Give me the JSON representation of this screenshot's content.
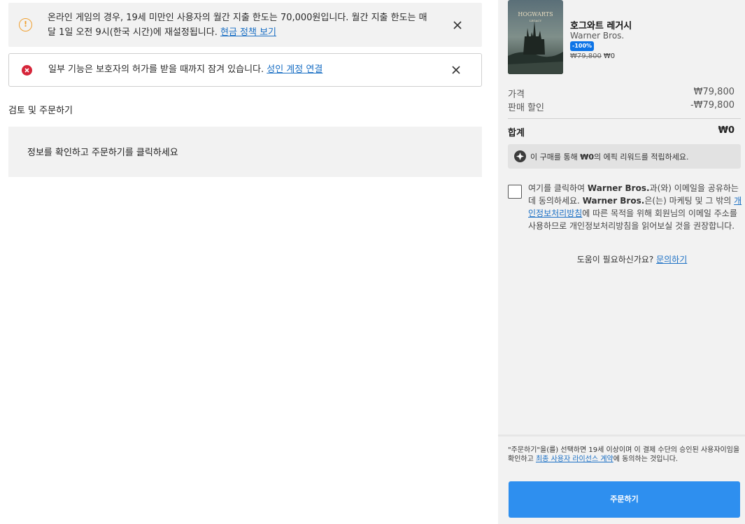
{
  "alerts": {
    "spending": {
      "icon": "warning-circle-icon",
      "line1": "온라인 게임의 경우, 19세 미만인 사용자의 월간 지출 한도는 70,000원입니다. 월간 지출 한도는 매",
      "line2": "달 1일 오전 9시(한국 시간)에 재설정됩니다.",
      "link": "현금 정책 보기"
    },
    "locked": {
      "icon": "error-circle-icon",
      "text": "일부 기능은 보호자의 허가를 받을 때까지 잠겨 있습니다.",
      "link": "성인 계정 연결"
    }
  },
  "main": {
    "title": "검토 및 주문하기",
    "review_text": "정보를 확인하고 주문하기를 클릭하세요"
  },
  "product": {
    "title": "호그와트 레거시",
    "publisher": "Warner Bros.",
    "discount_badge": "-100%",
    "original_price": "₩79,800",
    "final_price": "₩0"
  },
  "summary": {
    "price_label": "가격",
    "price_value": "₩79,800",
    "discount_label": "판매 할인",
    "discount_value": "-₩79,800",
    "total_label": "합계",
    "total_value": "₩0"
  },
  "reward": {
    "prefix": "이 구매를 통해 ",
    "amount": "₩0",
    "suffix": "의 에픽 리워드를 적립하세요."
  },
  "consent": {
    "p1": "여기를 클릭하여 ",
    "brand1": "Warner Bros.",
    "p2": "과(와) 이메일을 공유하는 데 동의하세요. ",
    "brand2": "Warner Bros.",
    "p3": "은(는) 마케팅 및 그 밖의 ",
    "link": "개인정보처리방침",
    "p4": "에 따른 목적을 위해 회원님의 이메일 주소를 사용하므로 개인정보처리방침을 읽어보실 것을 권장합니다."
  },
  "help": {
    "text": "도움이 필요하신가요?",
    "link": "문의하기"
  },
  "legal": {
    "p1": "\"주문하기\"을(를) 선택하면 19세 이상이며 이 결제 수단의 승인된 사용자이임을 확인하고 ",
    "link": "최종 사용자 라이선스 계약",
    "p2": "에 동의하는 것입니다."
  },
  "order_button": "주문하기",
  "colors": {
    "accent": "#2e8fef",
    "badge": "#0d74e7",
    "warning": "#f0a030",
    "error": "#d6263a",
    "link": "#1a6fc4"
  }
}
